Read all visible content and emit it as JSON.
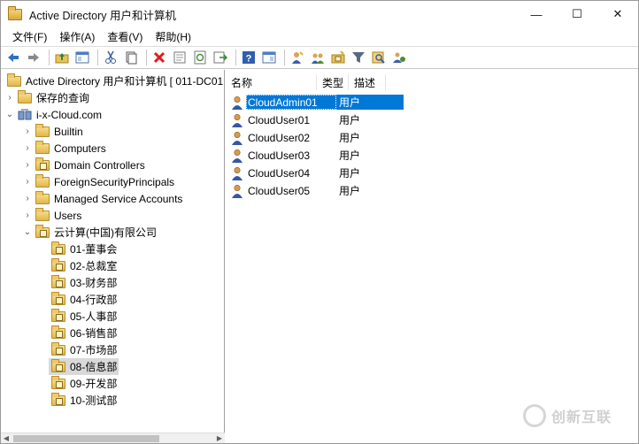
{
  "window": {
    "title": "Active Directory 用户和计算机",
    "controls": {
      "minimize": "—",
      "maximize": "☐",
      "close": "✕"
    }
  },
  "menu": [
    "文件(F)",
    "操作(A)",
    "查看(V)",
    "帮助(H)"
  ],
  "toolbar": {
    "buttons": [
      "back-icon",
      "forward-icon",
      "up-folder-icon",
      "show-tree-icon",
      "cut-icon",
      "copy-icon",
      "delete-icon",
      "properties-icon",
      "refresh-icon",
      "export-icon",
      "help-icon",
      "console-icon",
      "add-user-icon",
      "add-group-icon",
      "add-ou-icon",
      "filter-icon",
      "find-icon",
      "add-to-group-icon"
    ]
  },
  "tree": {
    "root": "Active Directory 用户和计算机 [ 011-DC01",
    "saved_queries": "保存的查询",
    "domain": "i-x-Cloud.com",
    "containers": [
      "Builtin",
      "Computers",
      "Domain Controllers",
      "ForeignSecurityPrincipals",
      "Managed Service Accounts",
      "Users"
    ],
    "company_ou": "云计算(中国)有限公司",
    "departments": [
      "01-董事会",
      "02-总裁室",
      "03-财务部",
      "04-行政部",
      "05-人事部",
      "06-销售部",
      "07-市场部",
      "08-信息部",
      "09-开发部",
      "10-测试部"
    ],
    "selected_department": "08-信息部"
  },
  "list": {
    "columns": [
      "名称",
      "类型",
      "描述"
    ],
    "rows": [
      {
        "name": "CloudAdmin01",
        "type": "用户",
        "description": ""
      },
      {
        "name": "CloudUser01",
        "type": "用户",
        "description": ""
      },
      {
        "name": "CloudUser02",
        "type": "用户",
        "description": ""
      },
      {
        "name": "CloudUser03",
        "type": "用户",
        "description": ""
      },
      {
        "name": "CloudUser04",
        "type": "用户",
        "description": ""
      },
      {
        "name": "CloudUser05",
        "type": "用户",
        "description": ""
      }
    ],
    "selected_row": "CloudAdmin01"
  },
  "watermark": "创新互联",
  "colors": {
    "selection": "#0078d7",
    "folder": "#e2b749"
  }
}
